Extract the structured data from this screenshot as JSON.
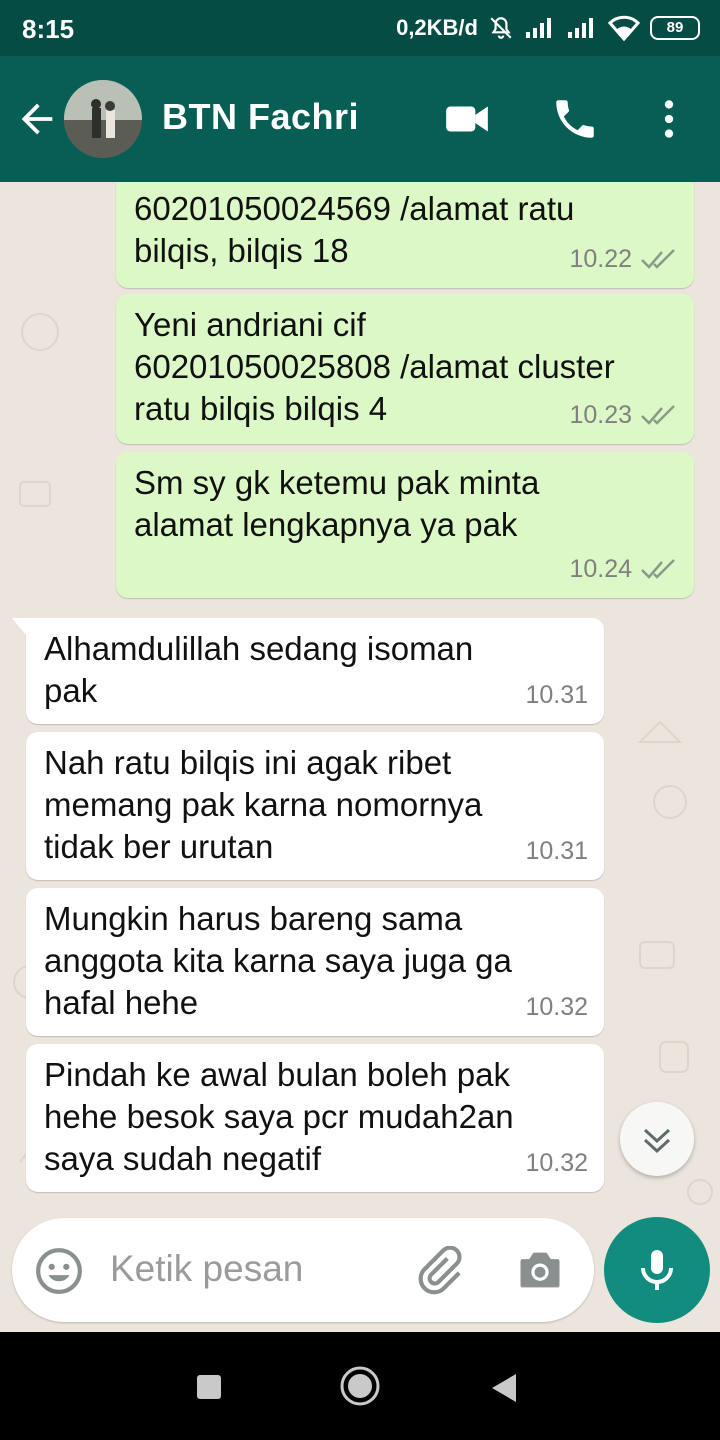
{
  "status_bar": {
    "time": "8:15",
    "network_speed": "0,2KB/d",
    "battery": "89",
    "icons": [
      "mute-icon",
      "signal-icon",
      "signal-icon",
      "wifi-icon",
      "battery-icon"
    ]
  },
  "header": {
    "contact_name": "BTN Fachri",
    "icons": [
      "back-arrow-icon",
      "avatar",
      "video-call-icon",
      "phone-icon",
      "more-vert-icon"
    ]
  },
  "messages": [
    {
      "direction": "out",
      "text": "60201050024569 /alamat ratu\nbilqis, bilqis 18",
      "time": "10.22",
      "status": "read"
    },
    {
      "direction": "out",
      "text": "Yeni andriani cif\n60201050025808 /alamat cluster\nratu bilqis bilqis 4",
      "time": "10.23",
      "status": "read"
    },
    {
      "direction": "out",
      "text": "Sm sy gk ketemu pak  minta\nalamat lengkapnya ya pak",
      "time": "10.24",
      "status": "read"
    },
    {
      "direction": "in",
      "text": "Alhamdulillah sedang isoman\npak",
      "time": "10.31"
    },
    {
      "direction": "in",
      "text": "Nah ratu bilqis ini agak ribet\nmemang pak karna nomornya\ntidak ber urutan",
      "time": "10.31"
    },
    {
      "direction": "in",
      "text": "Mungkin harus bareng sama\nanggota kita karna saya juga ga\nhafal hehe",
      "time": "10.32"
    },
    {
      "direction": "in",
      "text": "Pindah ke awal bulan boleh pak\nhehe besok saya pcr mudah2an\nsaya sudah negatif",
      "time": "10.32"
    }
  ],
  "input": {
    "placeholder": "Ketik pesan"
  },
  "colors": {
    "status_bar": "#054d44",
    "header": "#075e54",
    "outgoing_bubble": "#dcf8c6",
    "incoming_bubble": "#ffffff",
    "accent": "#128c7e",
    "read_ticks": "#8a9a8a",
    "chat_background": "#ece5dd"
  }
}
